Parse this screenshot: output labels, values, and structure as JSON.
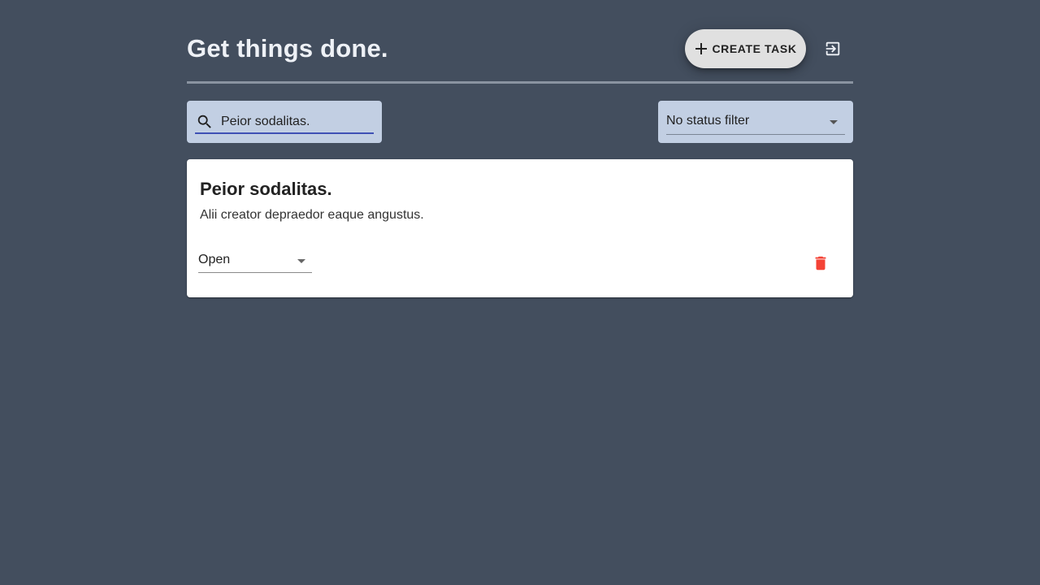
{
  "header": {
    "title": "Get things done.",
    "create_button_label": "CREATE TASK",
    "create_icon": "plus-icon",
    "logout_icon": "logout-icon"
  },
  "toolbar": {
    "search": {
      "icon": "search-icon",
      "value": "Peior sodalitas."
    },
    "status_filter": {
      "selected": "No status filter"
    }
  },
  "tasks": [
    {
      "title": "Peior sodalitas.",
      "description": "Alii creator depraedor eaque angustus.",
      "status": "Open",
      "delete_icon": "trash-icon"
    }
  ],
  "colors": {
    "background": "#434e5e",
    "title_text": "#eef1f6",
    "input_fill": "#c2cfe3",
    "input_focus": "#3f51b5",
    "delete_red": "#f44336",
    "card": "#ffffff"
  }
}
